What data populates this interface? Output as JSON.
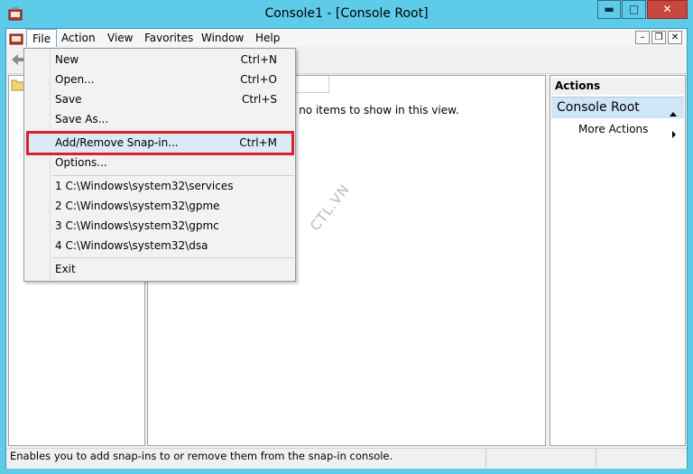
{
  "window": {
    "title": "Console1 - [Console Root]",
    "minimize_label": "▬",
    "maximize_label": "□",
    "close_label": "✕"
  },
  "menubar": {
    "items": [
      {
        "label": "File",
        "name": "menu-file"
      },
      {
        "label": "Action",
        "name": "menu-action"
      },
      {
        "label": "View",
        "name": "menu-view"
      },
      {
        "label": "Favorites",
        "name": "menu-favorites"
      },
      {
        "label": "Window",
        "name": "menu-window"
      },
      {
        "label": "Help",
        "name": "menu-help"
      }
    ],
    "mdi_minimize": "–",
    "mdi_restore": "❐",
    "mdi_close": "✕"
  },
  "file_menu": {
    "items": [
      {
        "label": "New",
        "shortcut": "Ctrl+N"
      },
      {
        "label": "Open...",
        "shortcut": "Ctrl+O"
      },
      {
        "label": "Save",
        "shortcut": "Ctrl+S"
      },
      {
        "label": "Save As...",
        "shortcut": ""
      },
      {
        "label": "Add/Remove Snap-in...",
        "shortcut": "Ctrl+M",
        "highlighted": true
      },
      {
        "label": "Options...",
        "shortcut": ""
      },
      {
        "label": "1 C:\\Windows\\system32\\services",
        "shortcut": ""
      },
      {
        "label": "2 C:\\Windows\\system32\\gpme",
        "shortcut": ""
      },
      {
        "label": "3 C:\\Windows\\system32\\gpmc",
        "shortcut": ""
      },
      {
        "label": "4 C:\\Windows\\system32\\dsa",
        "shortcut": ""
      },
      {
        "label": "Exit",
        "shortcut": ""
      }
    ]
  },
  "center_pane": {
    "empty_message": "e no items to show in this view."
  },
  "actions_pane": {
    "header": "Actions",
    "section_title": "Console Root",
    "more_actions": "More Actions"
  },
  "statusbar": {
    "text": "Enables you to add snap-ins to or remove them from the snap-in console."
  },
  "watermark": "CTL.VN",
  "colors": {
    "title_bar": "#5ecbe9",
    "close_button": "#c7463f",
    "highlight_box": "#d7242a",
    "menu_hover": "#dde9f6",
    "actions_section": "#cfe6f7"
  }
}
